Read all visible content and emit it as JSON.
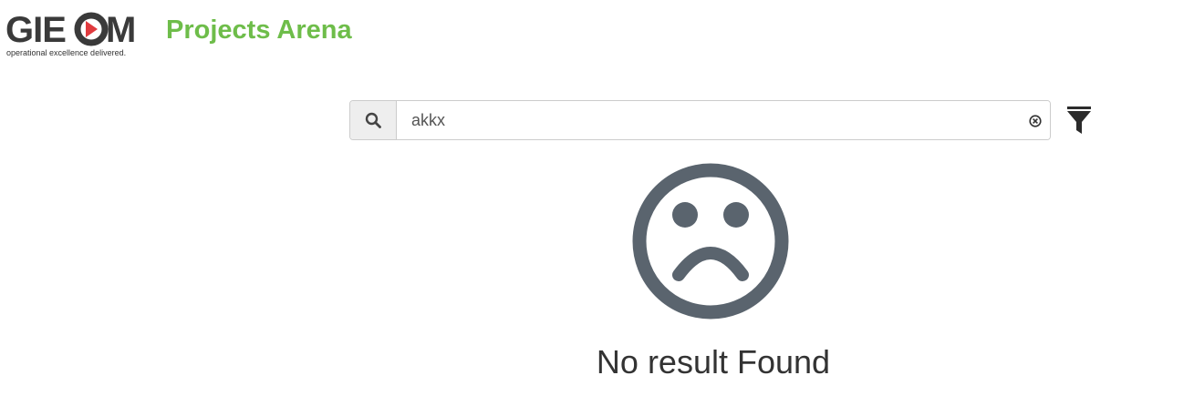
{
  "branding": {
    "logo_text": "GIEOM",
    "logo_tagline": "operational excellence delivered.",
    "app_title": "Projects Arena"
  },
  "search": {
    "value": "akkx",
    "search_icon": "search-icon",
    "clear_icon": "clear-circle-icon",
    "filter_icon": "filter-icon"
  },
  "empty_state": {
    "icon": "sad-face-icon",
    "message": "No result Found"
  },
  "colors": {
    "brand_green": "#6ebd4a",
    "logo_dark": "#3a3a3a",
    "logo_red": "#e03a3e",
    "icon_gray": "#5a646e"
  }
}
